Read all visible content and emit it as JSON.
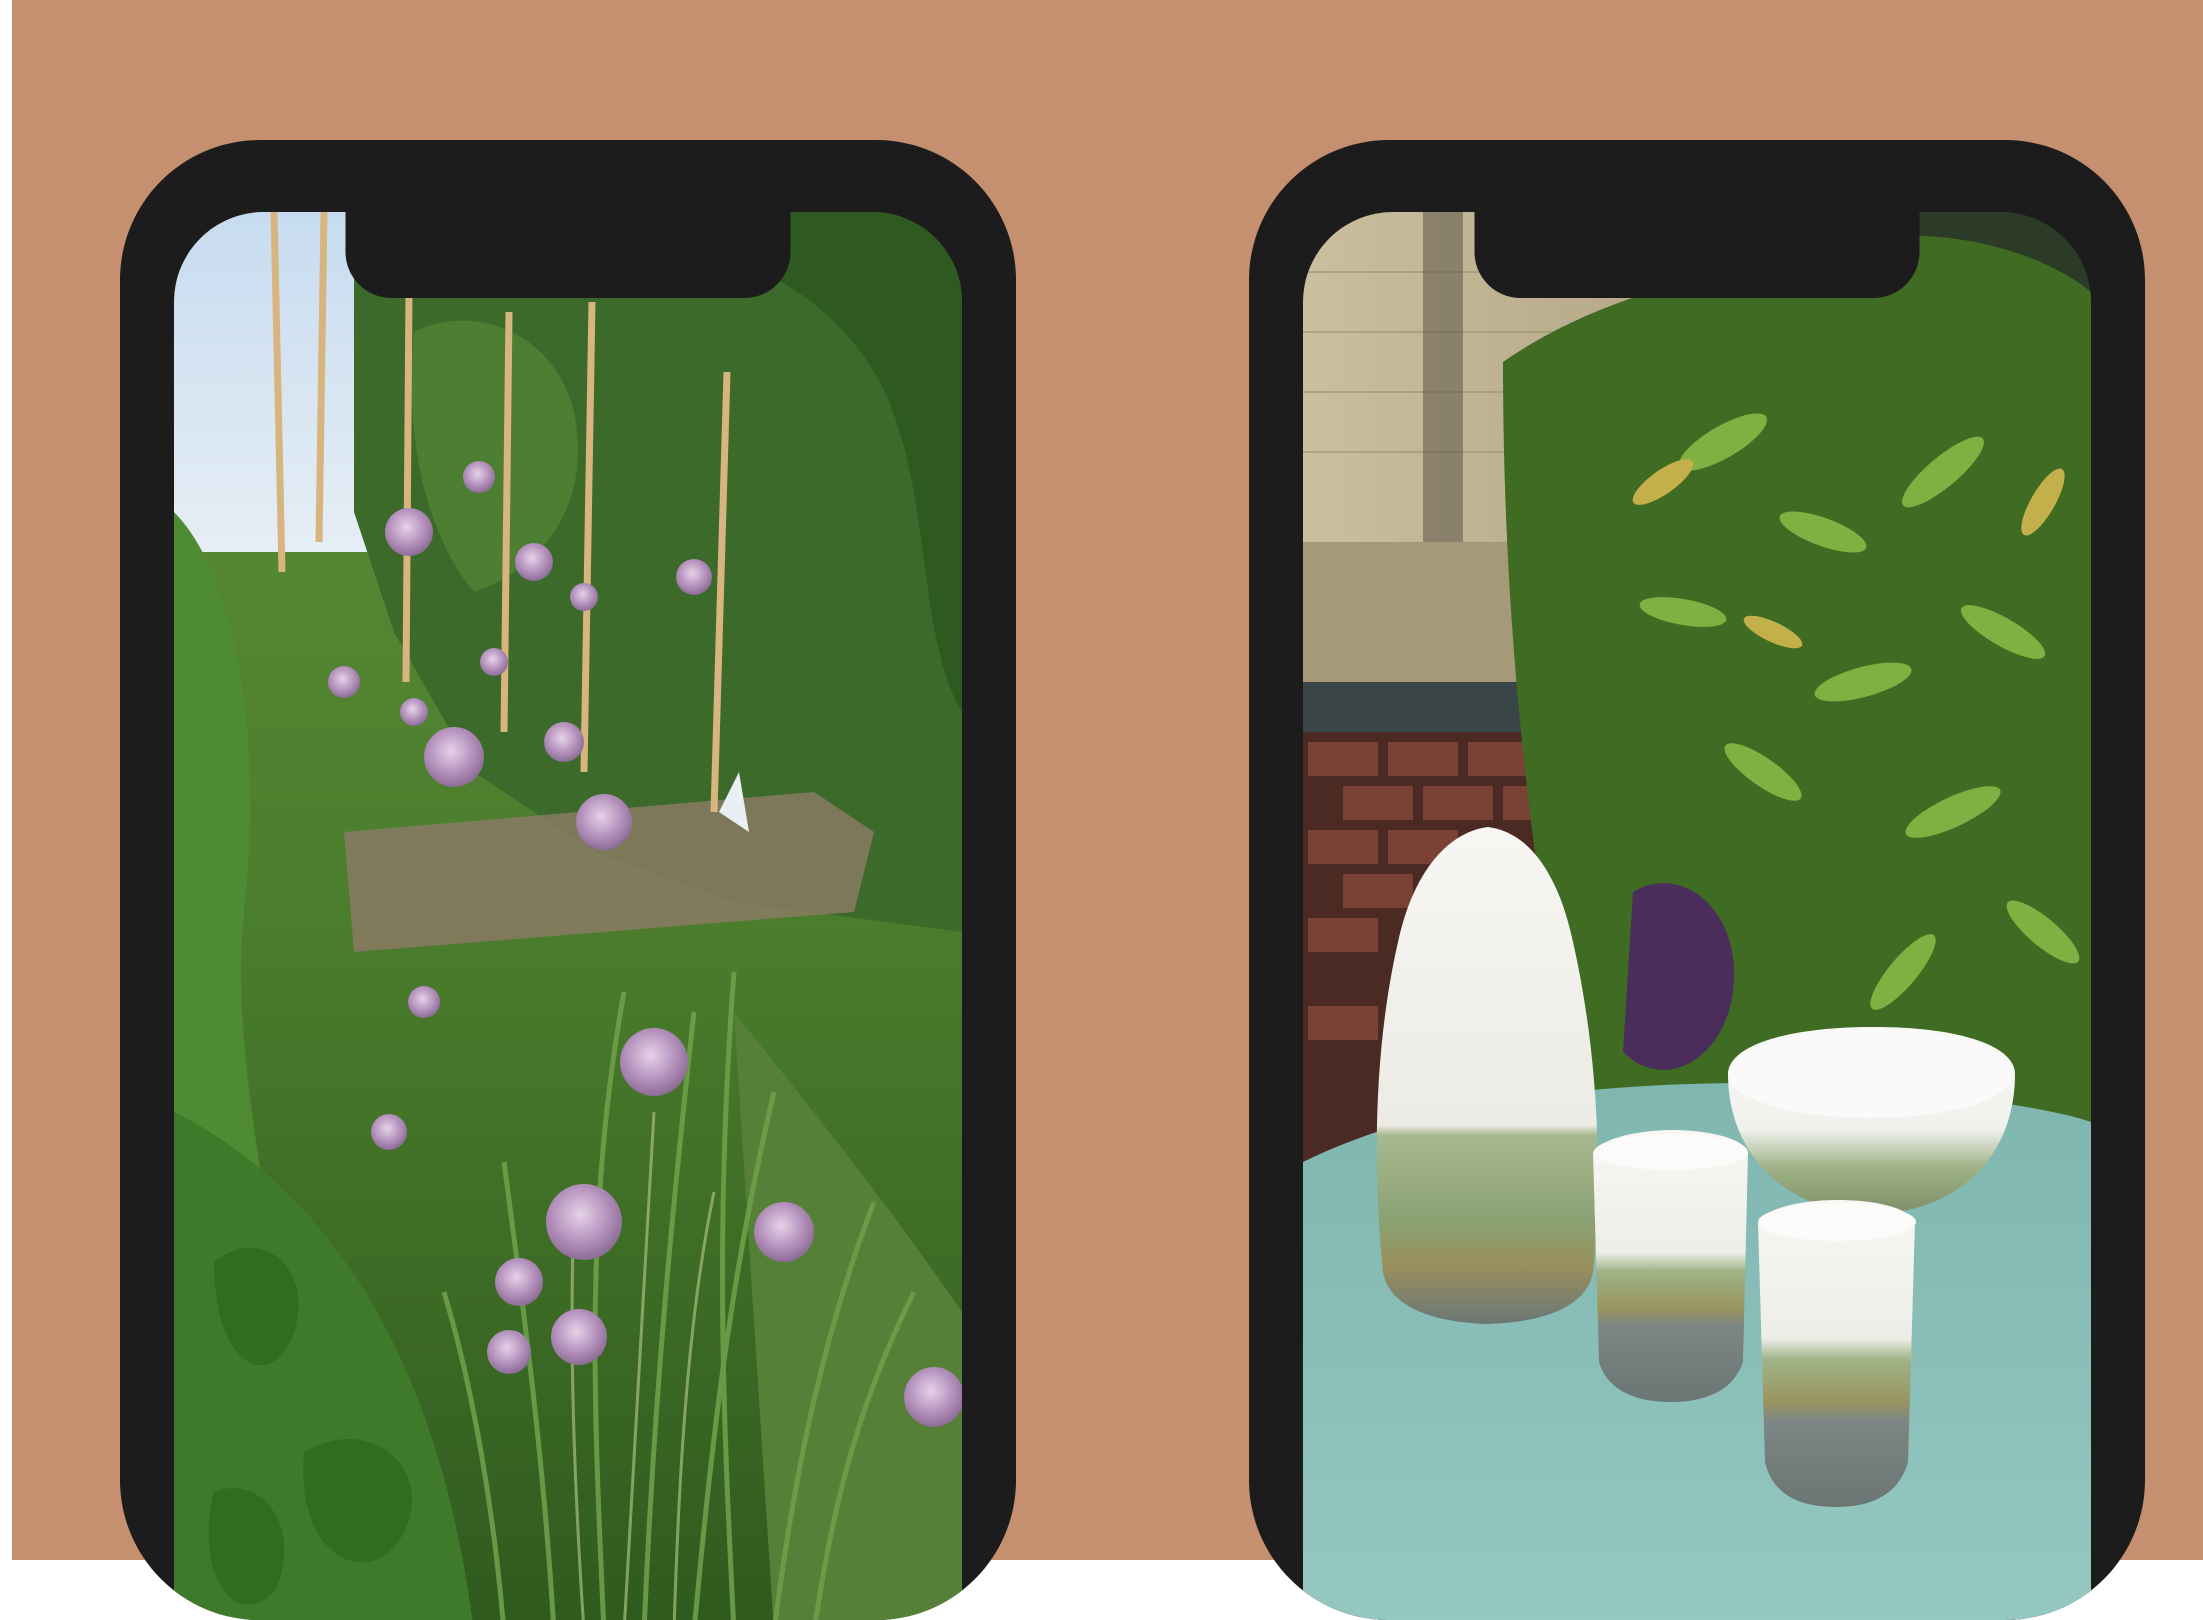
{
  "colors": {
    "background": "#c4906f",
    "margin": "#ffffff",
    "phone_frame": "#1c1c1c",
    "garden_green": "#3f7a2b",
    "sky": "#c9dff2",
    "chive_flower": "#b58fbc",
    "brick": "#5a2f24",
    "table_top": "#8fc4bd",
    "ceramic_white": "#f4f2ee",
    "glaze_green": "#8aa070",
    "stoneware_gray": "#6e7a78"
  },
  "mockups": [
    {
      "name": "left-phone",
      "photo": "garden-chive-flowers-photo"
    },
    {
      "name": "right-phone",
      "photo": "ceramic-vase-bowl-cups-photo"
    }
  ]
}
